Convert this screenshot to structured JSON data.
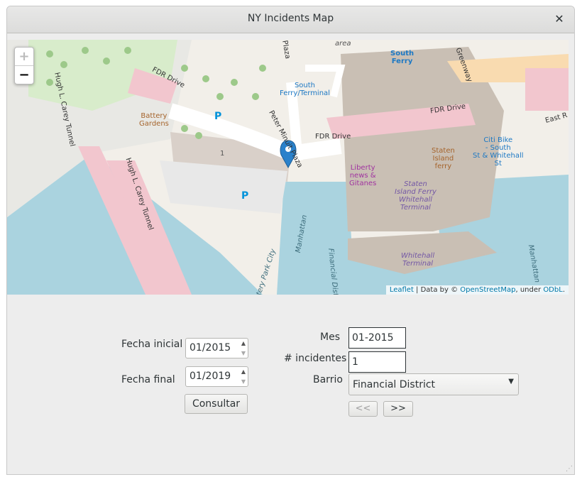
{
  "window": {
    "title": "NY Incidents Map",
    "close_glyph": "✕"
  },
  "map": {
    "zoom_in": "+",
    "zoom_out": "−",
    "attribution": {
      "leaflet": "Leaflet",
      "sep1": " | Data by © ",
      "osm": "OpenStreetMap",
      "sep2": ", under ",
      "odbl": "ODbL",
      "end": "."
    },
    "labels": {
      "fdr_drive_1": "FDR Drive",
      "fdr_drive_2": "FDR Drive",
      "fdr_drive_3": "FDR Drive",
      "carey_tunnel_1": "Hugh L. Carey Tunnel",
      "carey_tunnel_2": "Hugh L. Carey Tunnel",
      "battery_gardens": "Battery\nGardens",
      "south_ferry_terminal": "South\nFerry/Terminal",
      "south_ferry": "South\nFerry",
      "peter_minuit": "Peter Minuit Plaza",
      "plaza": "Plaza",
      "liberty_news": "Liberty\nnews &\nGitanes",
      "staten_island_ferry": "Staten\nIsland\nferry",
      "si_ferry_terminal": "Staten\nIsland Ferry\nWhitehall\nTerminal",
      "whitehall_terminal": "Whitehall\nTerminal",
      "citibike": "Citi Bike\n- South\nSt & Whitehall\nSt",
      "east_r": "East R",
      "area": "area",
      "manhattan_1": "Manhattan",
      "manhattan_2": "Manhattan",
      "financial_district": "Financial District",
      "battery_park_city": "Battery Park City",
      "greenway": "Greenway",
      "parking_1": "P",
      "parking_2": "P",
      "building_number": "1"
    }
  },
  "form": {
    "fecha_inicial_label": "Fecha inicial",
    "fecha_inicial_value": "01/2015",
    "fecha_final_label": "Fecha final",
    "fecha_final_value": "01/2019",
    "consultar_label": "Consultar",
    "mes_label": "Mes",
    "mes_value": "01-2015",
    "incidentes_label": "# incidentes",
    "incidentes_value": "1",
    "barrio_label": "Barrio",
    "barrio_value": "Financial District",
    "prev_label": "<<",
    "next_label": ">>"
  }
}
